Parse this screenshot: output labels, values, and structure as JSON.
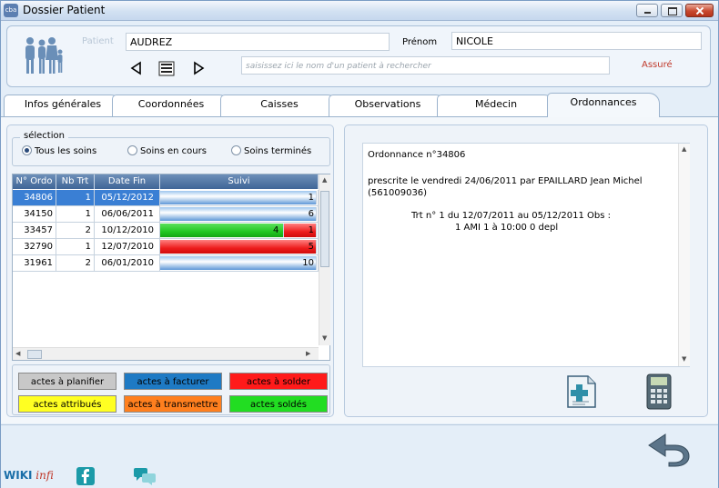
{
  "window": {
    "title": "Dossier Patient",
    "app_icon": "cba"
  },
  "patient": {
    "label_patient": "Patient",
    "nom": "AUDREZ",
    "label_prenom": "Prénom",
    "prenom": "NICOLE",
    "search_placeholder": "saisissez ici le nom d'un patient à rechercher",
    "status": "Assuré"
  },
  "tabs": [
    {
      "label": "Infos générales"
    },
    {
      "label": "Coordonnées"
    },
    {
      "label": "Caisses"
    },
    {
      "label": "Observations"
    },
    {
      "label": "Médecin"
    },
    {
      "label": "Ordonnances",
      "active": true
    }
  ],
  "selection": {
    "title": "sélection",
    "options": [
      "Tous les soins",
      "Soins en cours",
      "Soins terminés"
    ],
    "selected": "Tous les soins"
  },
  "table": {
    "headers": [
      "N° Ordo",
      "Nb Trt",
      "Date Fin",
      "Suivi"
    ],
    "rows": [
      {
        "ordo": "34806",
        "nb": "1",
        "date": "05/12/2012",
        "suivi": "1",
        "selected": true
      },
      {
        "ordo": "34150",
        "nb": "1",
        "date": "06/06/2011",
        "suivi": "6"
      },
      {
        "ordo": "33457",
        "nb": "2",
        "date": "10/12/2010",
        "suivi_a": "4",
        "suivi": "1"
      },
      {
        "ordo": "32790",
        "nb": "1",
        "date": "12/07/2010",
        "suivi": "5"
      },
      {
        "ordo": "31961",
        "nb": "2",
        "date": "06/01/2010",
        "suivi": "10"
      }
    ]
  },
  "legend": {
    "planifier": "actes à planifier",
    "facturer": "actes à facturer",
    "solder": "actes à solder",
    "attribues": "actes attribués",
    "transmettre": "actes à transmettre",
    "soldes": "actes soldés"
  },
  "colors": {
    "planifier": "#c8c8c8",
    "facturer": "#1e7ac4",
    "solder": "#ff1a1a",
    "attribues": "#ffff22",
    "transmettre": "#ff7f1e",
    "soldes": "#22dd22"
  },
  "ordonnance": {
    "title": "Ordonnance n°34806",
    "line1": "prescrite le vendredi 24/06/2011 par EPAILLARD Jean Michel",
    "line2": "(561009036)",
    "line3": "Trt n° 1 du 12/07/2011 au 05/12/2011 Obs :",
    "line4": "1 AMI 1 à 10:00 0 depl"
  },
  "footer": {
    "wiki": "WIKI",
    "infi": "infi"
  }
}
